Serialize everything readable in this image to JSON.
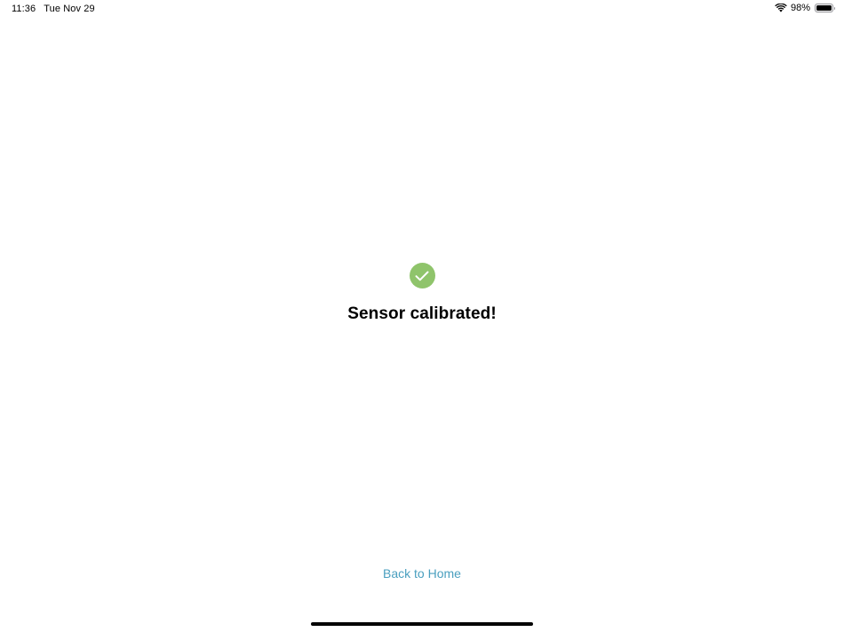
{
  "status_bar": {
    "time": "11:36",
    "date": "Tue Nov 29",
    "battery_percent": "98%",
    "battery_level": 0.98,
    "wifi_icon": "wifi-icon",
    "battery_icon": "battery-icon"
  },
  "main": {
    "icon": "checkmark-circle-icon",
    "icon_color": "#8fc46b",
    "title": "Sensor calibrated!"
  },
  "footer": {
    "back_label": "Back to Home",
    "link_color": "#4a9fbf"
  }
}
